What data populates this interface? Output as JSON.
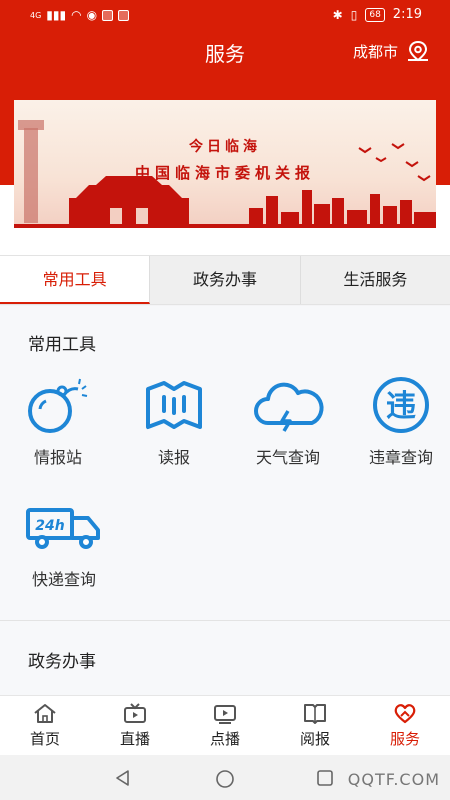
{
  "status_bar": {
    "signal": "4G",
    "battery": "68",
    "time": "2:19"
  },
  "header": {
    "title": "服务",
    "city": "成都市"
  },
  "banner": {
    "line1": "今日临海",
    "line2": "中国临海市委机关报"
  },
  "tabs": [
    {
      "label": "常用工具",
      "active": true
    },
    {
      "label": "政务办事",
      "active": false
    },
    {
      "label": "生活服务",
      "active": false
    }
  ],
  "sections": {
    "common_tools": "常用工具",
    "government": "政务办事"
  },
  "tools": [
    {
      "label": "情报站",
      "icon": "bomb-icon"
    },
    {
      "label": "读报",
      "icon": "map-icon"
    },
    {
      "label": "天气查询",
      "icon": "weather-cloud-icon"
    },
    {
      "label": "违章查询",
      "icon": "violation-icon"
    },
    {
      "label": "快递查询",
      "icon": "delivery-truck-icon"
    }
  ],
  "bottom_nav": [
    {
      "label": "首页",
      "icon": "home-icon",
      "active": false
    },
    {
      "label": "直播",
      "icon": "tv-icon",
      "active": false
    },
    {
      "label": "点播",
      "icon": "play-icon",
      "active": false
    },
    {
      "label": "阅报",
      "icon": "book-icon",
      "active": false
    },
    {
      "label": "服务",
      "icon": "heart-icon",
      "active": true
    }
  ],
  "colors": {
    "primary": "#d81e06",
    "icon_blue": "#1e86d6"
  },
  "watermark": "QQTF.COM"
}
